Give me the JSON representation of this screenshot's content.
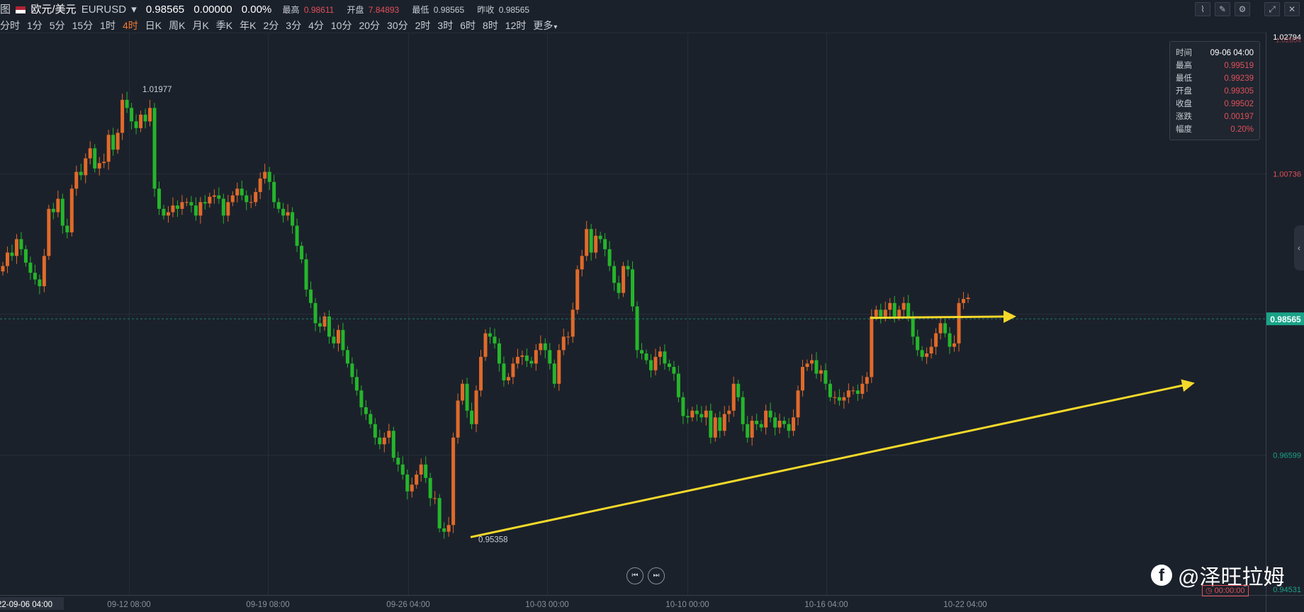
{
  "header": {
    "symbol_name": "欧元/美元",
    "symbol_code": "EURUSD",
    "price": "0.98565",
    "change": "0.00000",
    "change_pct": "0.00%",
    "stats": [
      {
        "label": "最高",
        "value": "0.98611"
      },
      {
        "label": "开盘",
        "value": "7.84893"
      },
      {
        "label": "最低",
        "value": "0.98565"
      },
      {
        "label": "昨收",
        "value": "0.98565"
      }
    ],
    "left_fragment": "图"
  },
  "intervals": {
    "items": [
      "分时",
      "1分",
      "5分",
      "15分",
      "1时",
      "4时",
      "日K",
      "周K",
      "月K",
      "季K",
      "年K",
      "2分",
      "3分",
      "4分",
      "10分",
      "20分",
      "30分",
      "2时",
      "3时",
      "6时",
      "8时",
      "12时",
      "更多"
    ],
    "active": "4时"
  },
  "info_box": {
    "time_label": "时间",
    "time_value": "09-06 04:00",
    "rows": [
      {
        "label": "最高",
        "value": "0.99519"
      },
      {
        "label": "最低",
        "value": "0.99239"
      },
      {
        "label": "开盘",
        "value": "0.99305"
      },
      {
        "label": "收盘",
        "value": "0.99502"
      },
      {
        "label": "涨跌",
        "value": "0.00197"
      },
      {
        "label": "幅度",
        "value": "0.20%"
      }
    ]
  },
  "watermark": "@泽旺拉姆",
  "countdown": "00:00:00",
  "colors": {
    "up": "#e06a2a",
    "down": "#25b52b",
    "accent": "#f2792d",
    "arrow": "#f5d92a",
    "price_tag": "#1aa389"
  },
  "chart_data": {
    "type": "candlestick",
    "x_labels": [
      "22-09-06 04:00",
      "09-12 08:00",
      "09-19 08:00",
      "09-26 04:00",
      "10-03 00:00",
      "10-10 00:00",
      "10-16 04:00",
      "10-22 04:00"
    ],
    "y_tick_labels": [
      "1.02794",
      "1.00736",
      "0.96599",
      "0.94531"
    ],
    "y_top_faint": "1.02804",
    "current_price": 0.98565,
    "current_price_label": "0.98565",
    "ylim": [
      0.9446,
      1.0282
    ],
    "annotations": [
      {
        "label": "1.01977",
        "value": 1.01977
      },
      {
        "label": "0.95358",
        "value": 0.95358
      }
    ],
    "trend_lines": [
      {
        "name": "horizontal-resistance",
        "from": [
          0.9858,
          "10-18"
        ],
        "to": [
          0.986,
          "10-27"
        ]
      },
      {
        "name": "rising-support",
        "from": [
          0.9532,
          "09-29"
        ],
        "to": [
          0.976,
          "10-29"
        ]
      }
    ],
    "closes": [
      0.9935,
      0.9955,
      0.995,
      0.9975,
      0.996,
      0.994,
      0.9925,
      0.9915,
      0.9905,
      0.995,
      1.002,
      1.0015,
      1.0035,
      0.9995,
      0.9985,
      1.005,
      1.0075,
      1.007,
      1.0095,
      1.011,
      1.008,
      1.0088,
      1.009,
      1.013,
      1.0108,
      1.0133,
      1.0182,
      1.017,
      1.015,
      1.014,
      1.016,
      1.015,
      1.017,
      1.005,
      1.002,
      1.001,
      1.0015,
      1.0025,
      1.002,
      1.003,
      1.003,
      1.0025,
      1.001,
      1.003,
      1.0028,
      1.0038,
      1.004,
      1.0035,
      1.001,
      1.003,
      1.004,
      1.005,
      1.004,
      1.003,
      1.003,
      1.0045,
      1.0065,
      1.0075,
      1.006,
      1.003,
      1.002,
      1.001,
      1.0015,
      0.9995,
      0.9965,
      0.9945,
      0.99,
      0.988,
      0.985,
      0.9845,
      0.986,
      0.983,
      0.982,
      0.984,
      0.981,
      0.979,
      0.977,
      0.975,
      0.9725,
      0.9715,
      0.97,
      0.968,
      0.967,
      0.968,
      0.969,
      0.965,
      0.964,
      0.9625,
      0.96,
      0.961,
      0.9625,
      0.964,
      0.962,
      0.959,
      0.959,
      0.9545,
      0.954,
      0.955,
      0.968,
      0.9735,
      0.976,
      0.972,
      0.97,
      0.975,
      0.98,
      0.9835,
      0.983,
      0.982,
      0.979,
      0.9765,
      0.977,
      0.979,
      0.98,
      0.9802,
      0.9794,
      0.979,
      0.981,
      0.982,
      0.981,
      0.979,
      0.976,
      0.981,
      0.983,
      0.983,
      0.987,
      0.993,
      0.995,
      0.999,
      0.9955,
      0.998,
      0.9975,
      0.996,
      0.9935,
      0.991,
      0.9895,
      0.9935,
      0.993,
      0.9875,
      0.981,
      0.9805,
      0.9795,
      0.978,
      0.98,
      0.9808,
      0.979,
      0.9785,
      0.9775,
      0.974,
      0.9712,
      0.971,
      0.972,
      0.9715,
      0.971,
      0.972,
      0.968,
      0.971,
      0.969,
      0.9715,
      0.972,
      0.976,
      0.974,
      0.97,
      0.968,
      0.9705,
      0.97,
      0.9695,
      0.972,
      0.971,
      0.9695,
      0.9705,
      0.97,
      0.969,
      0.971,
      0.975,
      0.9785,
      0.979,
      0.9795,
      0.9775,
      0.978,
      0.976,
      0.974,
      0.974,
      0.9735,
      0.974,
      0.975,
      0.975,
      0.9745,
      0.976,
      0.977,
      0.986,
      0.987,
      0.986,
      0.987,
      0.988,
      0.986,
      0.987,
      0.988,
      0.986,
      0.983,
      0.981,
      0.98,
      0.9805,
      0.9815,
      0.9835,
      0.985,
      0.9835,
      0.9815,
      0.982,
      0.988,
      0.9886,
      0.9888
    ]
  }
}
